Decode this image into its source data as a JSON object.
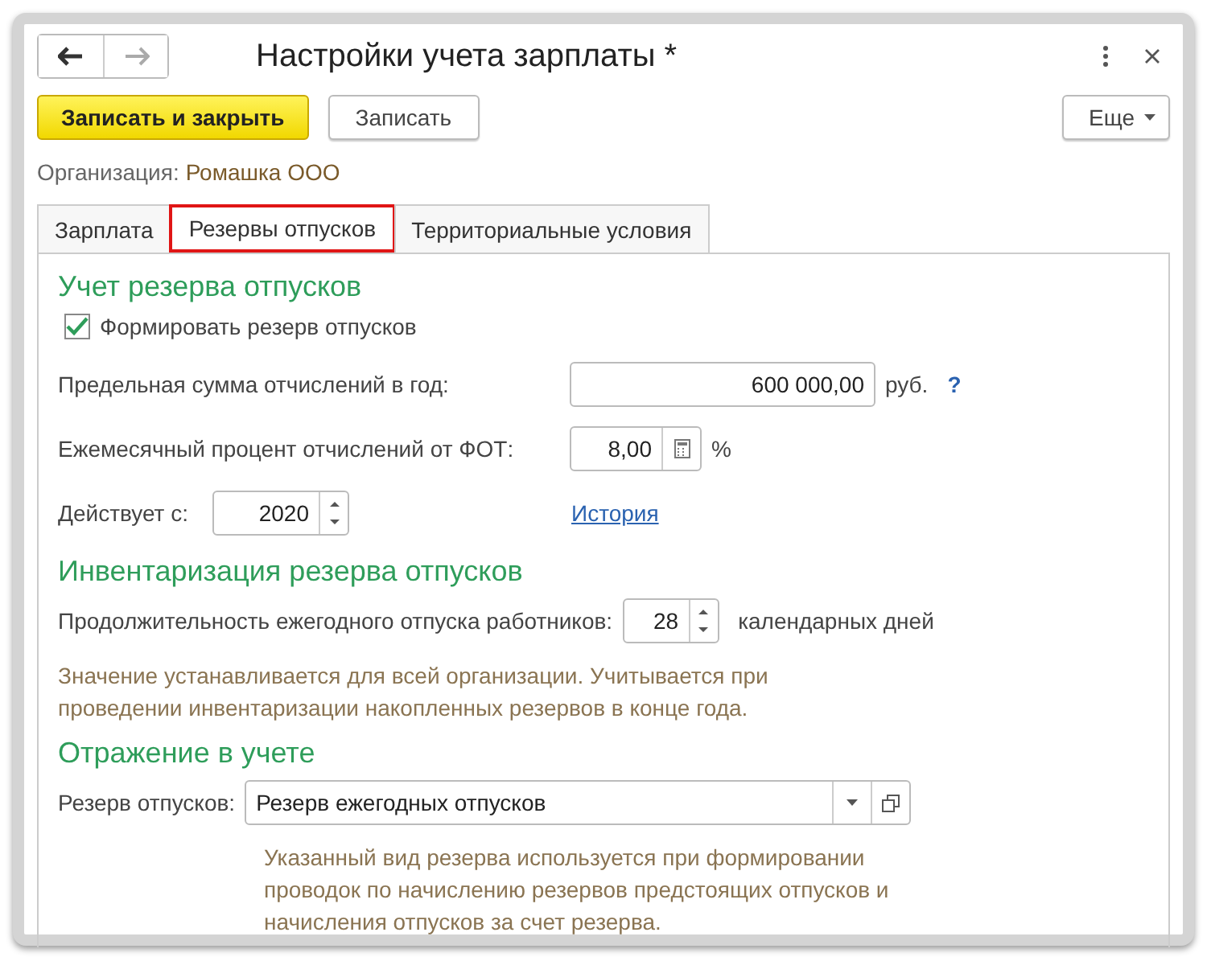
{
  "window": {
    "title": "Настройки учета зарплаты *",
    "more_label": "Еще"
  },
  "toolbar": {
    "primary": "Записать и закрыть",
    "secondary": "Записать"
  },
  "organization": {
    "label": "Организация:",
    "value": "Ромашка ООО"
  },
  "tabs": [
    {
      "label": "Зарплата",
      "selected": false
    },
    {
      "label": "Резервы отпусков",
      "selected": true
    },
    {
      "label": "Территориальные условия",
      "selected": false
    }
  ],
  "reserve": {
    "heading": "Учет резерва отпусков",
    "checkbox": {
      "label": "Формировать резерв отпусков",
      "checked": true
    },
    "limit": {
      "label": "Предельная сумма отчислений в год:",
      "value": "600 000,00",
      "unit": "руб.",
      "help": "?"
    },
    "percent": {
      "label": "Ежемесячный процент отчислений от ФОТ:",
      "value": "8,00",
      "unit": "%"
    },
    "since": {
      "label": "Действует с:",
      "value": "2020",
      "link": "История"
    }
  },
  "inventory": {
    "heading": "Инвентаризация резерва отпусков",
    "label": "Продолжительность ежегодного отпуска работников:",
    "value": "28",
    "unit": "календарных дней",
    "note": "Значение устанавливается для всей организации. Учитывается при проведении инвентаризации накопленных резервов в конце года."
  },
  "accounting": {
    "heading": "Отражение в учете",
    "label": "Резерв отпусков:",
    "value": "Резерв ежегодных отпусков",
    "note": "Указанный вид резерва используется при формировании проводок по начислению резервов предстоящих отпусков и начисления отпусков за счет резерва."
  }
}
